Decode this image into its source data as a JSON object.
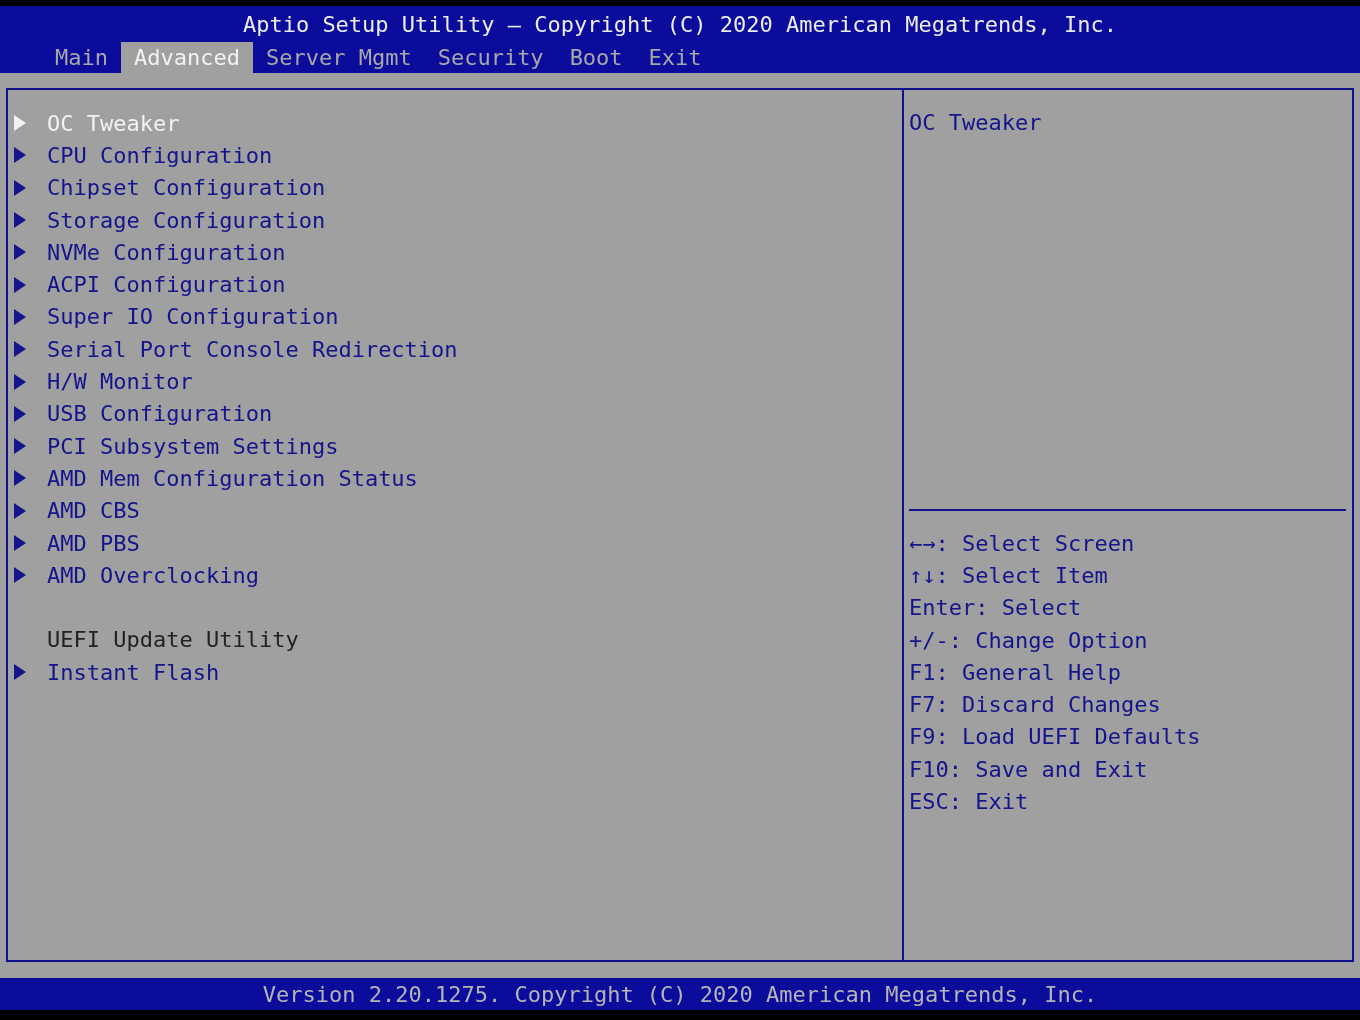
{
  "header": {
    "title": "Aptio Setup Utility – Copyright (C) 2020 American Megatrends, Inc."
  },
  "tabs": [
    {
      "label": "Main",
      "selected": false
    },
    {
      "label": "Advanced",
      "selected": true
    },
    {
      "label": "Server Mgmt",
      "selected": false
    },
    {
      "label": "Security",
      "selected": false
    },
    {
      "label": "Boot",
      "selected": false
    },
    {
      "label": "Exit",
      "selected": false
    }
  ],
  "menu": [
    {
      "kind": "submenu",
      "label": "OC Tweaker",
      "selected": true
    },
    {
      "kind": "submenu",
      "label": "CPU Configuration",
      "selected": false
    },
    {
      "kind": "submenu",
      "label": "Chipset Configuration",
      "selected": false
    },
    {
      "kind": "submenu",
      "label": "Storage Configuration",
      "selected": false
    },
    {
      "kind": "submenu",
      "label": "NVMe Configuration",
      "selected": false
    },
    {
      "kind": "submenu",
      "label": "ACPI Configuration",
      "selected": false
    },
    {
      "kind": "submenu",
      "label": "Super IO Configuration",
      "selected": false
    },
    {
      "kind": "submenu",
      "label": "Serial Port Console Redirection",
      "selected": false
    },
    {
      "kind": "submenu",
      "label": "H/W Monitor",
      "selected": false
    },
    {
      "kind": "submenu",
      "label": "USB Configuration",
      "selected": false
    },
    {
      "kind": "submenu",
      "label": "PCI Subsystem Settings",
      "selected": false
    },
    {
      "kind": "submenu",
      "label": "AMD Mem Configuration Status",
      "selected": false
    },
    {
      "kind": "submenu",
      "label": "AMD CBS",
      "selected": false
    },
    {
      "kind": "submenu",
      "label": "AMD PBS",
      "selected": false
    },
    {
      "kind": "submenu",
      "label": "AMD Overclocking",
      "selected": false
    },
    {
      "kind": "spacer"
    },
    {
      "kind": "label",
      "label": "UEFI Update Utility"
    },
    {
      "kind": "submenu",
      "label": "Instant Flash",
      "selected": false
    }
  ],
  "help": {
    "description": "OC Tweaker",
    "keys": [
      "←→: Select Screen",
      "↑↓: Select Item",
      "Enter: Select",
      "+/-: Change Option",
      "F1: General Help",
      "F7: Discard Changes",
      "F9: Load UEFI Defaults",
      "F10: Save and Exit",
      "ESC: Exit"
    ]
  },
  "footer": {
    "text": "Version 2.20.1275. Copyright (C) 2020 American Megatrends, Inc."
  }
}
